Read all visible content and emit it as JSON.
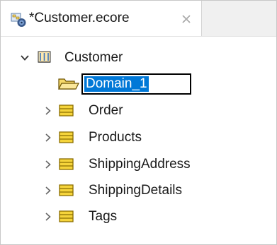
{
  "editor_tab": {
    "title": "*Customer.ecore",
    "icon": "ecore-model-icon",
    "close_icon": "close-icon"
  },
  "tree": {
    "root": {
      "label": "Customer",
      "icon": "package-icon",
      "expanded": true
    },
    "new_package": {
      "value": "Domain_1",
      "icon": "folder-open-icon",
      "selected": true
    },
    "classes": [
      {
        "label": "Order",
        "icon": "eclass-icon",
        "expanded": false
      },
      {
        "label": "Products",
        "icon": "eclass-icon",
        "expanded": false
      },
      {
        "label": "ShippingAddress",
        "icon": "eclass-icon",
        "expanded": false
      },
      {
        "label": "ShippingDetails",
        "icon": "eclass-icon",
        "expanded": false
      },
      {
        "label": "Tags",
        "icon": "eclass-icon",
        "expanded": false
      }
    ]
  },
  "colors": {
    "selection": "#0078d7",
    "class_icon_fill": "#f5d43b",
    "class_icon_stroke": "#8a6d00"
  }
}
